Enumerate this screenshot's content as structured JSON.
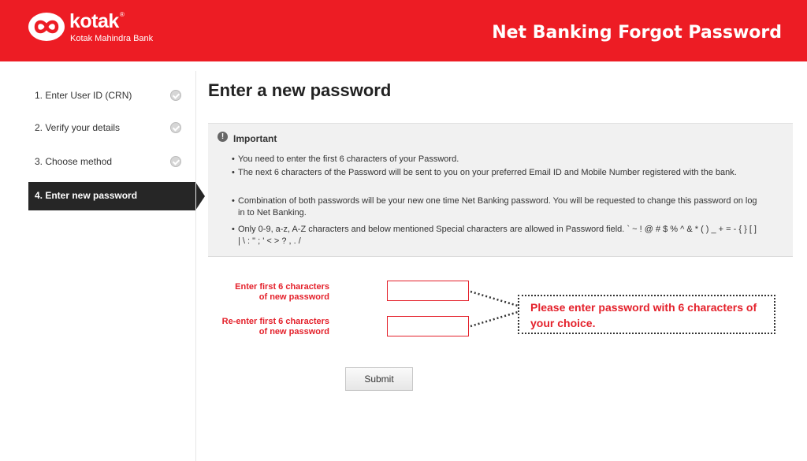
{
  "header": {
    "brand": "kotak",
    "brand_registered": "®",
    "brand_subtitle": "Kotak Mahindra Bank",
    "title": "Net Banking Forgot Password",
    "color": "#ed1c24"
  },
  "sidebar": {
    "steps": [
      {
        "label": "1. Enter User ID (CRN)",
        "status": "done",
        "icon": "check-circle-icon"
      },
      {
        "label": "2. Verify your details",
        "status": "done",
        "icon": "check-circle-icon"
      },
      {
        "label": "3. Choose method",
        "status": "done",
        "icon": "check-circle-icon"
      },
      {
        "label": "4. Enter new password",
        "status": "active"
      }
    ]
  },
  "main": {
    "title": "Enter a new password",
    "important": {
      "heading": "Important",
      "icon": "exclamation-icon",
      "items": [
        "You need to enter the first 6 characters of your Password.",
        "The next 6 characters of the Password will be sent to you on your preferred Email ID and Mobile Number registered with the bank.",
        "Combination of both passwords will be your new one time Net Banking password. You will be requested to change this password on log in to Net Banking.",
        "Only 0-9, a-z, A-Z characters and below mentioned Special characters are allowed in Password field. ` ~ ! @ # $ % ^ & * ( ) _ + = - { } [ ] | \\ : \" ; ' < > ? , . /"
      ]
    },
    "fields": [
      {
        "label_line1": "Enter first 6 characters",
        "label_line2": "of new password",
        "value": ""
      },
      {
        "label_line1": "Re-enter first 6 characters",
        "label_line2": "of new password",
        "value": ""
      }
    ],
    "callout": "Please enter password with 6 characters of your choice.",
    "submit_label": "Submit",
    "accent_color": "#e4212b"
  }
}
